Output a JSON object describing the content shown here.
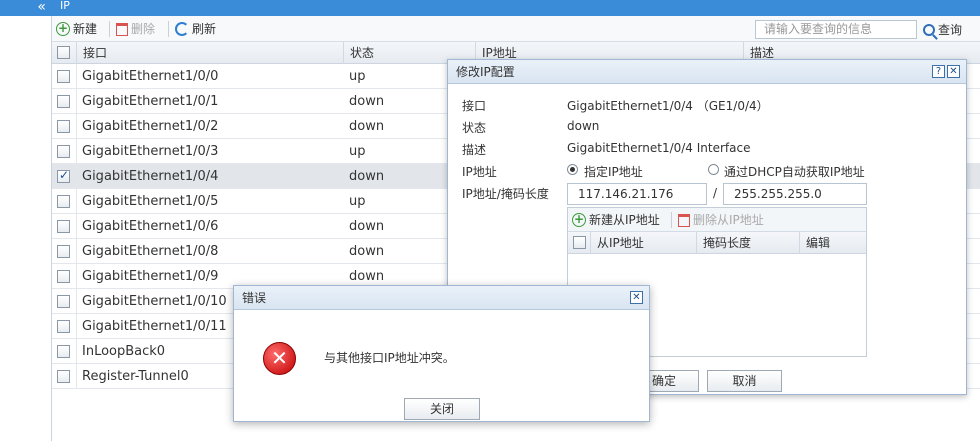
{
  "topbar": {
    "collapse_glyph": "«",
    "title": "IP"
  },
  "toolbar": {
    "new_label": "新建",
    "delete_label": "删除",
    "refresh_label": "刷新",
    "search_placeholder": "请输入要查询的信息",
    "search_label": "查询"
  },
  "table": {
    "headers": {
      "interface": "接口",
      "status": "状态",
      "ip": "IP地址",
      "desc": "描述"
    },
    "rows": [
      {
        "interface": "GigabitEthernet1/0/0",
        "status": "up",
        "checked": false
      },
      {
        "interface": "GigabitEthernet1/0/1",
        "status": "down",
        "checked": false
      },
      {
        "interface": "GigabitEthernet1/0/2",
        "status": "down",
        "checked": false
      },
      {
        "interface": "GigabitEthernet1/0/3",
        "status": "up",
        "checked": false
      },
      {
        "interface": "GigabitEthernet1/0/4",
        "status": "down",
        "checked": true
      },
      {
        "interface": "GigabitEthernet1/0/5",
        "status": "up",
        "checked": false
      },
      {
        "interface": "GigabitEthernet1/0/6",
        "status": "down",
        "checked": false
      },
      {
        "interface": "GigabitEthernet1/0/8",
        "status": "down",
        "checked": false
      },
      {
        "interface": "GigabitEthernet1/0/9",
        "status": "down",
        "checked": false
      },
      {
        "interface": "GigabitEthernet1/0/10",
        "status": "",
        "checked": false
      },
      {
        "interface": "GigabitEthernet1/0/11",
        "status": "",
        "checked": false
      },
      {
        "interface": "InLoopBack0",
        "status": "",
        "checked": false
      },
      {
        "interface": "Register-Tunnel0",
        "status": "",
        "checked": false
      }
    ]
  },
  "ip_dialog": {
    "title": "修改IP配置",
    "help_glyph": "?",
    "close_glyph": "✕",
    "interface_label": "接口",
    "interface_value": "GigabitEthernet1/0/4 （GE1/0/4）",
    "status_label": "状态",
    "status_value": "down",
    "desc_label": "描述",
    "desc_value": "GigabitEthernet1/0/4 Interface",
    "ip_label": "IP地址",
    "radio_manual": "指定IP地址",
    "radio_dhcp": "通过DHCP自动获取IP地址",
    "ipmask_label": "IP地址/掩码长度",
    "ip_value": "117.146.21.176",
    "slash": "/",
    "mask_value": "255.255.255.0",
    "sub_new_label": "新建从IP地址",
    "sub_delete_label": "删除从IP地址",
    "sub_headers": {
      "ip": "从IP地址",
      "mask": "掩码长度",
      "edit": "编辑"
    },
    "ok_label": "确定",
    "cancel_label": "取消"
  },
  "error_dialog": {
    "title": "错误",
    "close_glyph": "✕",
    "icon_glyph": "✕",
    "message": "与其他接口IP地址冲突。",
    "close_button": "关闭"
  }
}
